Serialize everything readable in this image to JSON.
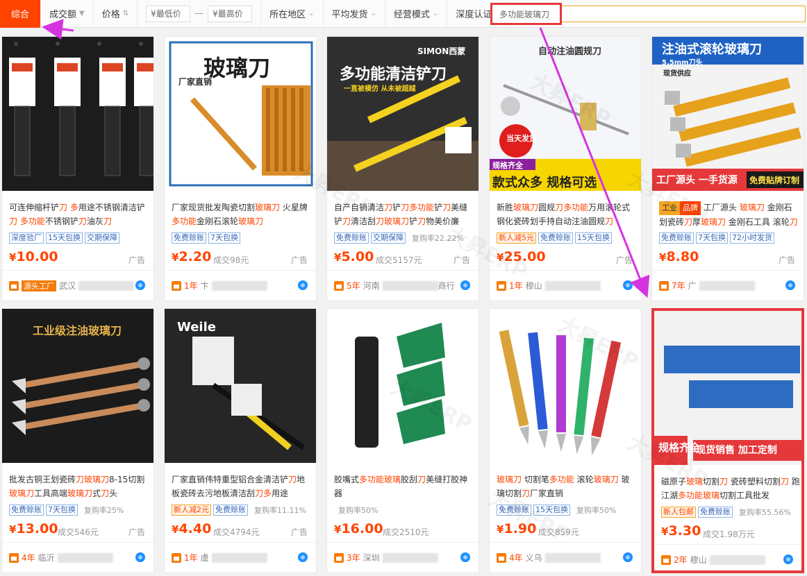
{
  "sortbar": {
    "items": [
      "综合",
      "成交额",
      "价格"
    ],
    "min_price": "¥最低价",
    "max_price": "¥最高价",
    "dash": "—",
    "filters": [
      "所在地区",
      "平均发货",
      "经营模式",
      "深度认证"
    ],
    "search_value": "多功能玻璃刀"
  },
  "watermark": "大昇ERP",
  "cards": [
    {
      "img_text": "",
      "title_parts": [
        [
          "可连伸缩杆铲",
          0
        ],
        [
          "刀",
          1
        ],
        [
          " ",
          0
        ],
        [
          "多",
          1
        ],
        [
          "用途不锈钢清洁铲",
          0
        ],
        [
          "刀",
          1
        ],
        [
          " ",
          0
        ],
        [
          "多功能",
          1
        ],
        [
          "不锈钢铲",
          0
        ],
        [
          "刀",
          1
        ],
        [
          "油灰",
          0
        ],
        [
          "刀",
          1
        ]
      ],
      "tags": [
        [
          "深度验厂",
          0
        ],
        [
          "15天包换",
          0
        ],
        [
          "交期保障",
          0
        ]
      ],
      "repurchase": "",
      "price": "10.00",
      "deals": "",
      "ad": "广告",
      "years": "",
      "shop_badge": "源头工厂",
      "shop": "武汉"
    },
    {
      "img_text": "玻璃刀",
      "img_sub": "厂家直销",
      "title_parts": [
        [
          "厂家现货批发陶瓷切割",
          0
        ],
        [
          "玻璃刀",
          1
        ],
        [
          " 火星牌",
          0
        ],
        [
          "多功能",
          1
        ],
        [
          "金刚石滚轮",
          0
        ],
        [
          "玻璃刀",
          1
        ]
      ],
      "tags": [
        [
          "免费赊账",
          0
        ],
        [
          "7天包换",
          0
        ]
      ],
      "repurchase": "",
      "price": "2.20",
      "deals": "成交98元",
      "ad": "广告",
      "years": "1年",
      "shop": "卞"
    },
    {
      "img_text": "多功能清洁铲刀",
      "img_sub": "一直被模仿 从未被超越",
      "img_brand": "SIMON西蒙",
      "title_parts": [
        [
          "自产自销清洁",
          0
        ],
        [
          "刀",
          1
        ],
        [
          "铲",
          0
        ],
        [
          "刀",
          1
        ],
        [
          "多功能",
          1
        ],
        [
          "铲",
          0
        ],
        [
          "刀",
          1
        ],
        [
          "美缝铲",
          0
        ],
        [
          "刀",
          1
        ],
        [
          "清洁刮",
          0
        ],
        [
          "刀玻璃刀",
          1
        ],
        [
          "铲",
          0
        ],
        [
          "刀",
          1
        ],
        [
          "物美价廉",
          0
        ]
      ],
      "tags": [
        [
          "免费赊账",
          0
        ],
        [
          "交期保障",
          0
        ]
      ],
      "repurchase": "复购率22.22%",
      "price": "5.00",
      "deals": "成交5157元",
      "ad": "广告",
      "years": "5年",
      "shop": "河南",
      "shop_tail": "商行"
    },
    {
      "img_text": "自动注油圆规刀",
      "img_sub": "当天发货",
      "img_bottom1": "规格齐全",
      "img_bottom2": "款式众多 规格可选",
      "title_parts": [
        [
          "新胜",
          0
        ],
        [
          "玻璃刀",
          1
        ],
        [
          "圆规",
          0
        ],
        [
          "刀",
          1
        ],
        [
          "多功能",
          1
        ],
        [
          "万用滚轮式钢化瓷砖划手持自动注油圆规",
          0
        ],
        [
          "刀",
          1
        ]
      ],
      "tags": [
        [
          "新人减5元",
          1
        ],
        [
          "免费赊账",
          0
        ],
        [
          "15天包换",
          0
        ]
      ],
      "repurchase": "",
      "price": "25.00",
      "deals": "",
      "ad": "广告",
      "years": "1年",
      "shop": "穆山"
    },
    {
      "img_text": "注油式滚轮玻璃刀",
      "img_sub": "5.5mm刀头",
      "img_sub2": "现货供应",
      "img_bottom1": "工厂源头 一手货源",
      "img_bottom2": "免费贴牌订制",
      "title_parts": [
        [
          "工厂源头 ",
          0
        ],
        [
          "玻璃刀",
          1
        ],
        [
          " 金刚石划瓷砖",
          0
        ],
        [
          "刀",
          1
        ],
        [
          "厚",
          0
        ],
        [
          "玻璃刀",
          1
        ],
        [
          " 金刚石工具 滚轮",
          0
        ],
        [
          "刀",
          1
        ]
      ],
      "line_badge1": "工业",
      "line_badge2": "品牌",
      "tags": [
        [
          "免费赊账",
          0
        ],
        [
          "7天包换",
          0
        ],
        [
          "72小时发货",
          0
        ]
      ],
      "repurchase": "",
      "price": "8.80",
      "deals": "",
      "ad": "广告",
      "years": "7年",
      "shop": "广"
    },
    {
      "img_text": "工业级注油玻璃刀",
      "title_parts": [
        [
          "批发古铜王划瓷砖",
          0
        ],
        [
          "刀玻璃刀",
          1
        ],
        [
          "8-15切割",
          0
        ],
        [
          "玻璃刀",
          1
        ],
        [
          "工具高端",
          0
        ],
        [
          "玻璃刀",
          1
        ],
        [
          "式",
          0
        ],
        [
          "刀",
          1
        ],
        [
          "头",
          0
        ]
      ],
      "tags": [
        [
          "免费赊账",
          0
        ],
        [
          "7天包换",
          0
        ]
      ],
      "repurchase": "复购率25%",
      "price": "13.00",
      "deals": "成交546元",
      "ad": "广告",
      "years": "4年",
      "shop": "临沂"
    },
    {
      "img_text": "Weile",
      "title_parts": [
        [
          "厂家直销伟特重型铝合金清洁铲",
          0
        ],
        [
          "刀",
          1
        ],
        [
          "地板瓷砖去污地板清洁刮",
          0
        ],
        [
          "刀",
          1
        ],
        [
          "多",
          1
        ],
        [
          "用途",
          0
        ]
      ],
      "tags": [
        [
          "新人减2元",
          1
        ],
        [
          "免费赊账",
          0
        ]
      ],
      "repurchase": "复购率11.11%",
      "price": "4.40",
      "deals": "成交4794元",
      "ad": "广告",
      "years": "1年",
      "shop": "虞"
    },
    {
      "img_text": "",
      "title_parts": [
        [
          "胶嘴式",
          0
        ],
        [
          "多功能玻璃",
          1
        ],
        [
          "胶刮",
          0
        ],
        [
          "刀",
          1
        ],
        [
          "美缝打胶神器",
          0
        ]
      ],
      "tags": [],
      "repurchase": "复购率50%",
      "price": "16.00",
      "deals": "成交2510元",
      "ad": "",
      "years": "3年",
      "shop": "深圳"
    },
    {
      "img_text": "",
      "title_parts": [
        [
          "玻璃刀",
          1
        ],
        [
          " 切割笔",
          0
        ],
        [
          "多功能",
          1
        ],
        [
          " 滚轮",
          0
        ],
        [
          "玻璃刀",
          1
        ],
        [
          " 玻璃切割",
          0
        ],
        [
          "刀",
          1
        ],
        [
          "厂家直销",
          0
        ]
      ],
      "tags": [
        [
          "免费赊账",
          0
        ],
        [
          "15天包换",
          0
        ]
      ],
      "repurchase": "复购率50%",
      "price": "1.90",
      "deals": "成交859元",
      "ad": "",
      "years": "4年",
      "shop": "义乌"
    },
    {
      "img_text": "规格齐全",
      "img_sub": "现货销售 加工定制",
      "title_parts": [
        [
          "磁原子",
          0
        ],
        [
          "玻璃",
          1
        ],
        [
          "切割",
          0
        ],
        [
          "刀",
          1
        ],
        [
          " 瓷砖塑料切割",
          0
        ],
        [
          "刀",
          1
        ],
        [
          " 跑江湖",
          0
        ],
        [
          "多功能玻璃",
          1
        ],
        [
          "切割工具批发",
          0
        ]
      ],
      "tags": [
        [
          "新人包邮",
          1
        ],
        [
          "免费赊账",
          0
        ]
      ],
      "repurchase": "复购率55.56%",
      "price": "3.30",
      "deals": "成交1.98万元",
      "ad": "",
      "years": "2年",
      "shop": "穆山"
    }
  ]
}
